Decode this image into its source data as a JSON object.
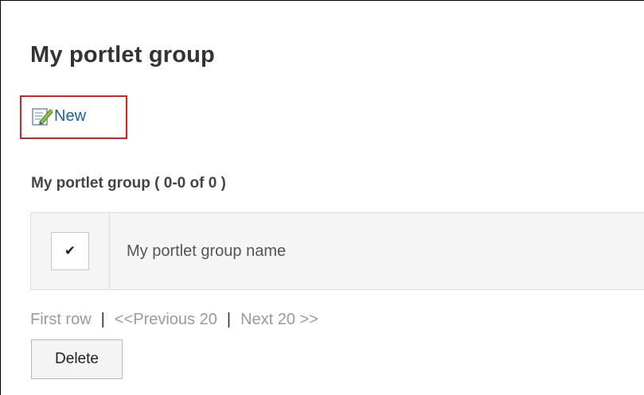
{
  "page": {
    "title": "My portlet group"
  },
  "actions": {
    "new_label": "New",
    "new_icon": "edit-note-icon"
  },
  "list": {
    "section_title": "My portlet group ( 0-0 of 0 )",
    "column_header": "My portlet group name",
    "select_all_checked": true,
    "select_all_glyph": "✔"
  },
  "pager": {
    "first": "First row",
    "separator": "|",
    "previous": "<<Previous 20",
    "next": "Next 20 >>"
  },
  "footer": {
    "delete_label": "Delete"
  },
  "colors": {
    "highlight": "#e02020",
    "link": "#1a5fb4",
    "disabled_text": "#9a9a9a"
  }
}
